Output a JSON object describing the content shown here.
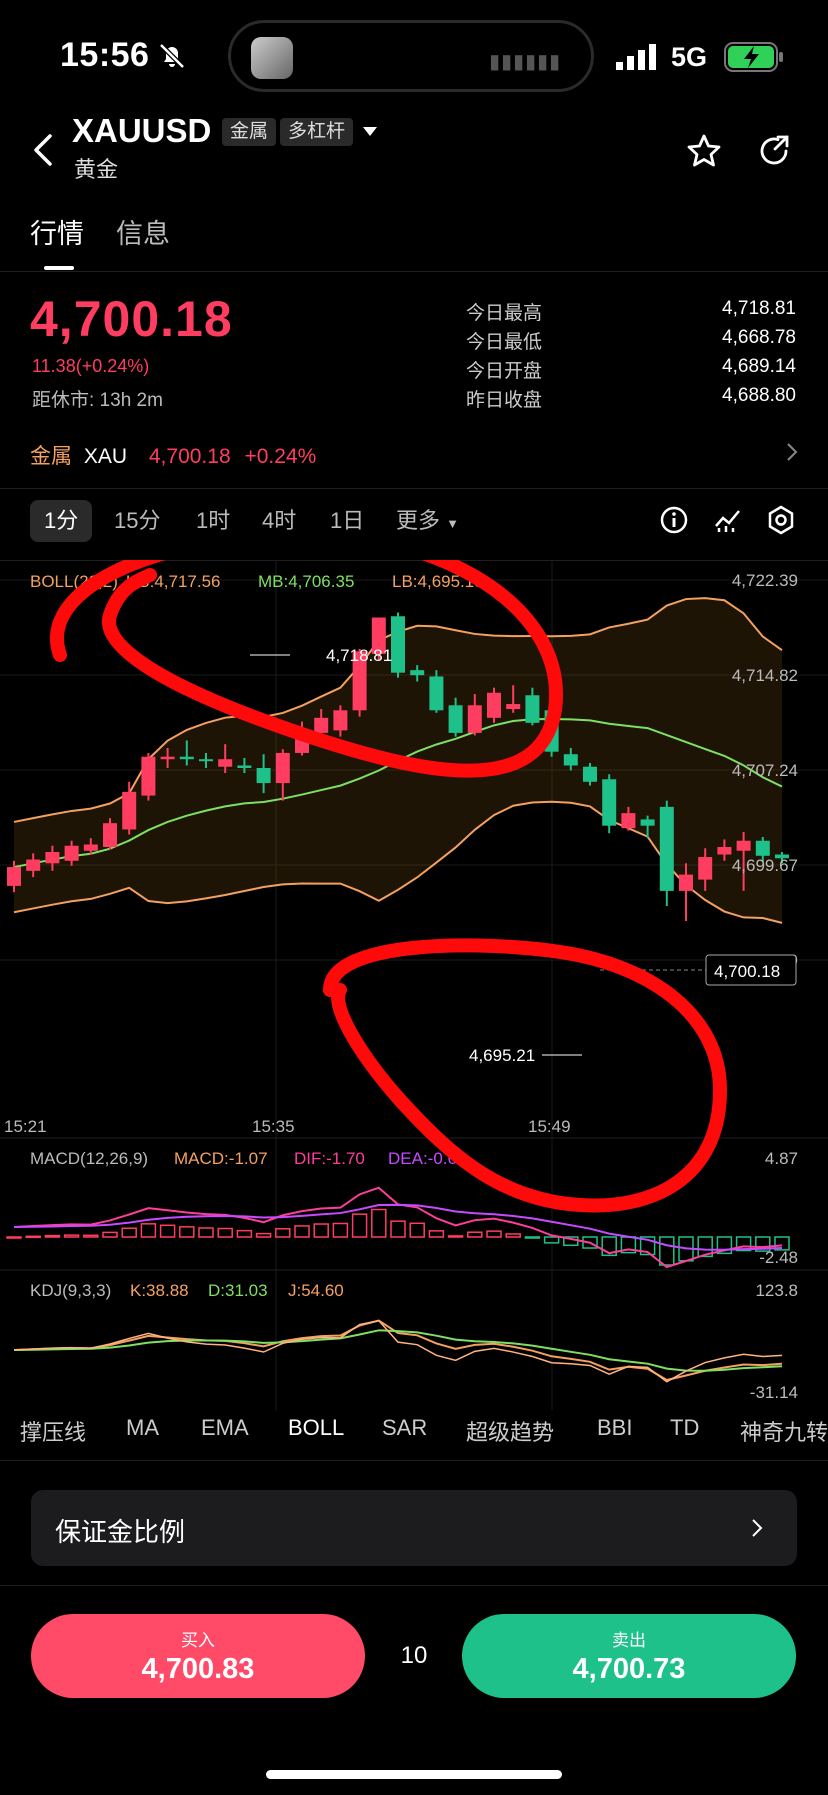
{
  "status": {
    "time": "15:56",
    "network": "5G"
  },
  "header": {
    "symbol": "XAUUSD",
    "tag1": "金属",
    "tag2": "多杠杆",
    "name": "黄金"
  },
  "tabs": [
    {
      "label": "行情"
    },
    {
      "label": "信息"
    }
  ],
  "quote": {
    "price": "4,700.18",
    "change": "11.38(+0.24%)",
    "close_in": "距休市: 13h 2m",
    "stats": [
      {
        "label": "今日最高",
        "value": "4,718.81"
      },
      {
        "label": "今日最低",
        "value": "4,668.78"
      },
      {
        "label": "今日开盘",
        "value": "4,689.14"
      },
      {
        "label": "昨日收盘",
        "value": "4,688.80"
      }
    ]
  },
  "metal_row": {
    "label": "金属",
    "code": "XAU",
    "price": "4,700.18",
    "change": "+0.24%"
  },
  "periods": [
    {
      "label": "1分"
    },
    {
      "label": "15分"
    },
    {
      "label": "1时"
    },
    {
      "label": "4时"
    },
    {
      "label": "1日"
    },
    {
      "label": "更多"
    }
  ],
  "chart_data": [
    {
      "type": "candlestick",
      "indicator": "BOLL(20,2)",
      "ub": "UB:4,717.56",
      "mb": "MB:4,706.35",
      "lb": "LB:4,695.15",
      "ylim": [
        4692.09,
        4722.39
      ],
      "yticks": [
        "4,722.39",
        "4,714.82",
        "4,707.24",
        "4,699.67",
        "4,692.09"
      ],
      "xticks": [
        "15:21",
        "15:35",
        "15:49"
      ],
      "annotations": {
        "high": "4,718.81",
        "low": "4,695.21",
        "current": "4,700.18"
      },
      "candles": [
        [
          4698.0,
          4699.5,
          4697.5,
          4700.0
        ],
        [
          4699.2,
          4700.1,
          4698.7,
          4700.6
        ],
        [
          4699.8,
          4700.7,
          4699.2,
          4701.2
        ],
        [
          4700.0,
          4701.2,
          4699.6,
          4701.6
        ],
        [
          4700.8,
          4701.3,
          4700.5,
          4701.8
        ],
        [
          4701.1,
          4703.0,
          4700.9,
          4703.4
        ],
        [
          4702.5,
          4705.5,
          4702.1,
          4706.3
        ],
        [
          4705.2,
          4708.3,
          4704.8,
          4708.6
        ],
        [
          4708.1,
          4708.3,
          4707.4,
          4709.0
        ],
        [
          4708.3,
          4708.1,
          4707.6,
          4709.6
        ],
        [
          4708.1,
          4708.0,
          4707.4,
          4708.6
        ],
        [
          4707.5,
          4708.1,
          4707.0,
          4709.3
        ],
        [
          4707.6,
          4707.4,
          4707.0,
          4708.2
        ],
        [
          4707.4,
          4706.2,
          4705.4,
          4708.5
        ],
        [
          4706.2,
          4708.6,
          4704.8,
          4708.9
        ],
        [
          4708.6,
          4710.2,
          4708.4,
          4711.1
        ],
        [
          4710.2,
          4711.4,
          4709.8,
          4712.1
        ],
        [
          4710.4,
          4712.0,
          4709.9,
          4712.4
        ],
        [
          4712.0,
          4716.7,
          4711.5,
          4716.9
        ],
        [
          4716.5,
          4719.4,
          4716.0,
          4718.8
        ],
        [
          4719.5,
          4715.0,
          4714.6,
          4719.8
        ],
        [
          4715.2,
          4714.8,
          4714.3,
          4715.6
        ],
        [
          4714.7,
          4712.0,
          4711.8,
          4715.2
        ],
        [
          4712.4,
          4710.2,
          4709.9,
          4713.0
        ],
        [
          4710.2,
          4712.4,
          4710.0,
          4713.3
        ],
        [
          4711.4,
          4713.4,
          4711.0,
          4713.8
        ],
        [
          4712.1,
          4712.5,
          4711.8,
          4714.0
        ],
        [
          4713.2,
          4711.0,
          4710.8,
          4713.8
        ],
        [
          4712.0,
          4708.7,
          4708.3,
          4712.3
        ],
        [
          4708.5,
          4707.6,
          4707.2,
          4709.0
        ],
        [
          4707.5,
          4706.3,
          4706.0,
          4707.8
        ],
        [
          4706.5,
          4702.8,
          4702.2,
          4706.9
        ],
        [
          4702.6,
          4703.8,
          4702.4,
          4704.3
        ],
        [
          4703.3,
          4702.8,
          4701.8,
          4703.6
        ],
        [
          4704.3,
          4697.6,
          4696.4,
          4704.8
        ],
        [
          4697.6,
          4698.9,
          4695.2,
          4699.8
        ],
        [
          4698.5,
          4700.3,
          4697.6,
          4701.0
        ],
        [
          4700.5,
          4701.1,
          4700.0,
          4701.7
        ],
        [
          4700.8,
          4701.6,
          4697.6,
          4702.3
        ],
        [
          4701.6,
          4700.4,
          4699.9,
          4701.9
        ],
        [
          4700.5,
          4700.2,
          4699.8,
          4700.7
        ]
      ]
    },
    {
      "type": "bar",
      "indicator": "MACD(12,26,9)",
      "macd": "MACD:-1.07",
      "dif": "DIF:-1.70",
      "dea": "DEA:-0.63",
      "ytop": "4.87",
      "ybottom": "-2.48"
    },
    {
      "type": "line",
      "indicator": "KDJ(9,3,3)",
      "k": "K:38.88",
      "d": "D:31.03",
      "j": "J:54.60",
      "ytop": "123.8",
      "ybottom": "-31.14"
    }
  ],
  "indicator_tabs": [
    {
      "label": "撑压线"
    },
    {
      "label": "MA"
    },
    {
      "label": "EMA"
    },
    {
      "label": "BOLL"
    },
    {
      "label": "SAR"
    },
    {
      "label": "超级趋势"
    },
    {
      "label": "BBI"
    },
    {
      "label": "TD"
    },
    {
      "label": "神奇九转"
    }
  ],
  "margin": {
    "label": "保证金比例"
  },
  "trade": {
    "buy_label": "买入",
    "buy_price": "4,700.83",
    "lots": "10",
    "sell_label": "卖出",
    "sell_price": "4,700.73"
  },
  "colors": {
    "up": "#ff3d60",
    "down": "#1fc18a",
    "boll_ub": "#f4a160",
    "boll_mb": "#7ee063",
    "annotation": "#ff0a0a"
  }
}
